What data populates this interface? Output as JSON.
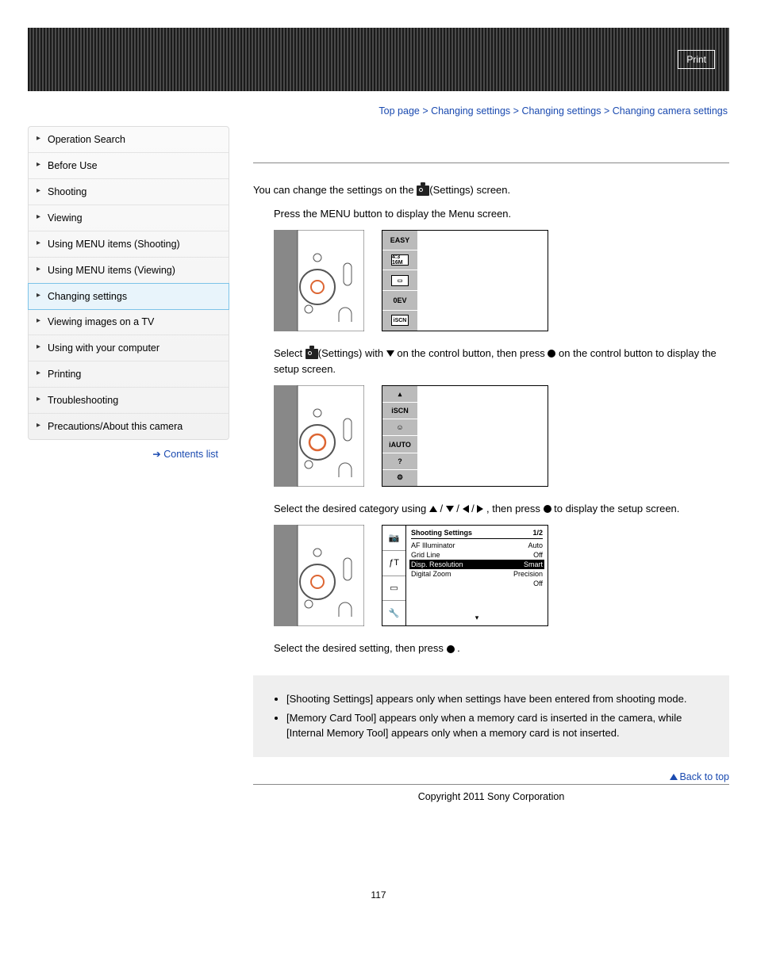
{
  "header": {
    "print": "Print"
  },
  "breadcrumb": {
    "items": [
      "Top page",
      "Changing settings",
      "Changing settings",
      "Changing camera settings"
    ],
    "sep": " > "
  },
  "sidebar": {
    "items": [
      {
        "label": "Operation Search",
        "active": false
      },
      {
        "label": "Before Use",
        "active": false
      },
      {
        "label": "Shooting",
        "active": false
      },
      {
        "label": "Viewing",
        "active": false
      },
      {
        "label": "Using MENU items (Shooting)",
        "active": false
      },
      {
        "label": "Using MENU items (Viewing)",
        "active": false
      },
      {
        "label": "Changing settings",
        "active": true
      },
      {
        "label": "Viewing images on a TV",
        "active": false
      },
      {
        "label": "Using with your computer",
        "active": false
      },
      {
        "label": "Printing",
        "active": false
      },
      {
        "label": "Troubleshooting",
        "active": false
      },
      {
        "label": "Precautions/About this camera",
        "active": false
      }
    ],
    "contents_link": "Contents list"
  },
  "content": {
    "intro_a": "You can change the settings on the ",
    "intro_b": "(Settings) screen.",
    "step1": "Press the MENU button to display the Menu screen.",
    "step2_a": "Select ",
    "step2_b": "(Settings) with ",
    "step2_c": " on the control button, then press ",
    "step2_d": " on the control button to display the setup screen.",
    "step3_a": "Select the desired category using ",
    "step3_b": " / ",
    "step3_c": " / ",
    "step3_d": " / ",
    "step3_e": " , then press ",
    "step3_f": " to display the setup screen.",
    "step4_a": "Select the desired setting, then press ",
    "step4_b": " ."
  },
  "fig1_menu_items": [
    "EASY",
    "4:3 16M",
    "▭",
    "0EV",
    "iSCN"
  ],
  "fig2_menu_items": [
    "▴",
    "iSCN",
    "☺",
    "iAUTO",
    "?",
    "⚙"
  ],
  "fig3": {
    "left_icons": [
      "📷",
      "ƒT",
      "▭",
      "🔧"
    ],
    "title": "Shooting Settings",
    "page": "1/2",
    "rows": [
      {
        "name": "AF Illuminator",
        "value": "Auto"
      },
      {
        "name": "Grid Line",
        "value": "Off"
      },
      {
        "name": "Disp. Resolution",
        "value": "Smart",
        "hl": true
      },
      {
        "name": "Digital Zoom",
        "value": "Precision"
      },
      {
        "name": "",
        "value": "Off"
      }
    ]
  },
  "notes": [
    "[Shooting Settings] appears only when settings have been entered from shooting mode.",
    "[Memory Card Tool] appears only when a memory card is inserted in the camera, while [Internal Memory Tool] appears only when a memory card is not inserted."
  ],
  "back_to_top": "Back to top",
  "copyright": "Copyright 2011 Sony Corporation",
  "page_number": "117"
}
